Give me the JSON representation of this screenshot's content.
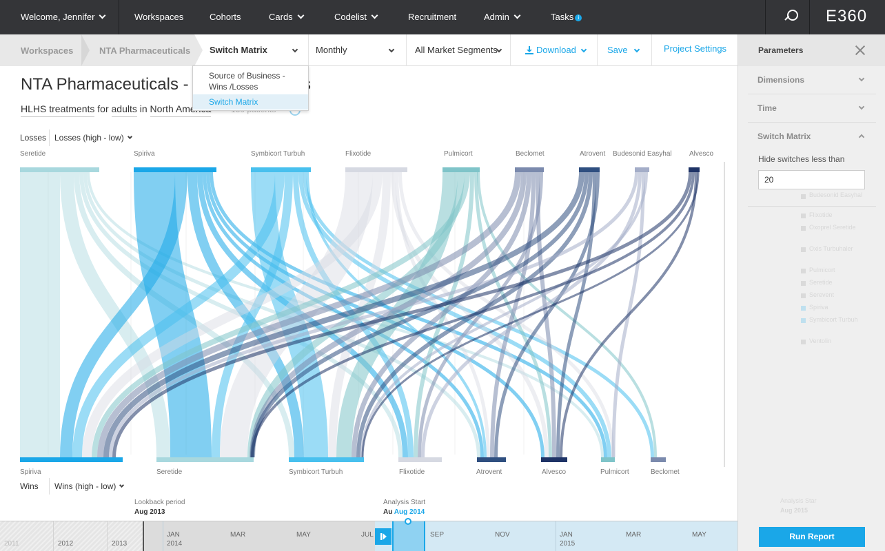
{
  "nav": {
    "welcome": "Welcome, Jennifer",
    "workspaces": "Workspaces",
    "cohorts": "Cohorts",
    "cards": "Cards",
    "codelist": "Codelist",
    "recruitment": "Recruitment",
    "admin": "Admin",
    "tasks": "Tasks",
    "tasks_badge": "i",
    "brand": "E360"
  },
  "breadcrumb": [
    "Workspaces",
    "NTA Pharmaceuticals"
  ],
  "toolbar": {
    "view_select": "Switch Matrix",
    "period_select": "Monthly",
    "segment_select": "All Market Segments",
    "download": "Download",
    "save": "Save",
    "project_settings": "Project Settings"
  },
  "view_menu": {
    "options": [
      "Source of Business - Wins /Losses",
      "Switch Matrix"
    ],
    "selected": "Switch Matrix"
  },
  "page": {
    "title": "NTA Pharmaceuticals - M",
    "title_tail": "ches",
    "treatment": "HLHS treatments",
    "for": " for ",
    "population": "adults",
    "in": " in ",
    "region": "North America",
    "patients": "150 patients"
  },
  "losses": {
    "label": "Losses",
    "sort": "Losses (high - low)"
  },
  "wins": {
    "label": "Wins",
    "sort": "Wins (high - low)"
  },
  "chart_data": {
    "type": "sankey",
    "top_nodes": [
      "Seretide",
      "Spiriva",
      "Symbicort Turbuh",
      "Flixotide",
      "Pulmicort",
      "Beclomet",
      "Atrovent",
      "Budesonid Easyhal",
      "Alvesco"
    ],
    "bottom_nodes": [
      "Spiriva",
      "Seretide",
      "Symbicort Turbuh",
      "Flixotide",
      "Atrovent",
      "Alvesco",
      "Pulmicort",
      "Beclomet"
    ],
    "colors": {
      "Seretide": "#a8d8de",
      "Spiriva": "#1aa7e8",
      "Symbicort Turbuh": "#48c0ee",
      "Flixotide": "#d6d9e2",
      "Pulmicort": "#7fc4c9",
      "Beclomet": "#7b8aad",
      "Atrovent": "#2f4f80",
      "Budesonid Easyhal": "#a4adc8",
      "Alvesco": "#1e3366"
    }
  },
  "timeline": {
    "lookback_label": "Lookback period",
    "lookback_value": "Aug 2013",
    "analysis_label": "Analysis Start",
    "analysis_prefix": "Au",
    "analysis_value": "Aug 2014",
    "years": [
      "2011",
      "2012",
      "2013"
    ],
    "months": [
      "JAN",
      "MAR",
      "MAY",
      "JUL",
      "SEP",
      "NOV",
      "JAN",
      "MAR",
      "MAY"
    ],
    "month_years": [
      "2014",
      "2015"
    ]
  },
  "panel": {
    "title": "Parameters",
    "sections": [
      "Dimensions",
      "Time",
      "Switch Matrix"
    ],
    "hide_label": "Hide switches less than",
    "hide_value": "20",
    "ghost_items": [
      "Budesonid Easyhal",
      "Flixotide",
      "Oxoprel Seretide",
      "Oxis Turbuhaler",
      "Pulmicort",
      "Seretide",
      "Serevent",
      "Spiriva",
      "Symbicort Turbuh",
      "Ventolin"
    ],
    "ghost_bottom_label": "Analysis Star",
    "ghost_bottom_value": "Aug 2015",
    "run_button": "Run Report"
  }
}
